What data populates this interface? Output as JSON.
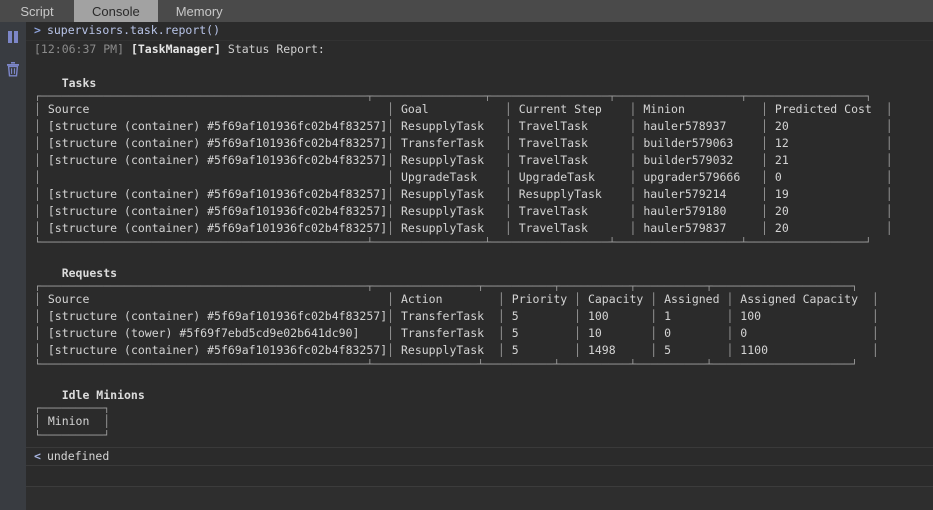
{
  "tabs": [
    {
      "label": "Script",
      "active": false
    },
    {
      "label": "Console",
      "active": true
    },
    {
      "label": "Memory",
      "active": false
    }
  ],
  "gutter": {
    "pause_icon": "pause-icon",
    "trash_icon": "trash-icon",
    "icon_color": "#7c86c8"
  },
  "console": {
    "command": "supervisors.task.report()",
    "input_prompt": ">",
    "output_prompt": "<",
    "output_value": "undefined",
    "status": {
      "timestamp": "[12:06:37 PM]",
      "tag": "[TaskManager]",
      "text": "Status Report:"
    },
    "sections": [
      {
        "title": "Tasks",
        "columns": [
          "Source",
          "Goal",
          "Current Step",
          "Minion",
          "Predicted Cost"
        ],
        "widths": [
          46,
          15,
          16,
          17,
          16
        ],
        "rows": [
          [
            "[structure (container) #5f69af101936fc02b4f83257]",
            "ResupplyTask",
            "TravelTask",
            "hauler578937",
            "20"
          ],
          [
            "[structure (container) #5f69af101936fc02b4f83257]",
            "TransferTask",
            "TravelTask",
            "builder579063",
            "12"
          ],
          [
            "[structure (container) #5f69af101936fc02b4f83257]",
            "ResupplyTask",
            "TravelTask",
            "builder579032",
            "21"
          ],
          [
            "",
            "UpgradeTask",
            "UpgradeTask",
            "upgrader579666",
            "0"
          ],
          [
            "[structure (container) #5f69af101936fc02b4f83257]",
            "ResupplyTask",
            "ResupplyTask",
            "hauler579214",
            "19"
          ],
          [
            "[structure (container) #5f69af101936fc02b4f83257]",
            "ResupplyTask",
            "TravelTask",
            "hauler579180",
            "20"
          ],
          [
            "[structure (container) #5f69af101936fc02b4f83257]",
            "ResupplyTask",
            "TravelTask",
            "hauler579837",
            "20"
          ]
        ]
      },
      {
        "title": "Requests",
        "columns": [
          "Source",
          "Action",
          "Priority",
          "Capacity",
          "Assigned",
          "Assigned Capacity"
        ],
        "widths": [
          46,
          14,
          9,
          9,
          9,
          19
        ],
        "rows": [
          [
            "[structure (container) #5f69af101936fc02b4f83257]",
            "TransferTask",
            "5",
            "100",
            "1",
            "100"
          ],
          [
            "[structure (tower) #5f69f7ebd5cd9e02b641dc90]",
            "TransferTask",
            "5",
            "10",
            "0",
            "0"
          ],
          [
            "[structure (container) #5f69af101936fc02b4f83257]",
            "ResupplyTask",
            "5",
            "1498",
            "5",
            "1100"
          ]
        ]
      },
      {
        "title": "Idle Minions",
        "columns": [
          "Minion"
        ],
        "widths": [
          8
        ],
        "rows": []
      }
    ]
  },
  "colors": {
    "console_bg": "#2b2b2b",
    "gutter_bg": "#393c41",
    "tabbar_bg": "#4a4a4a",
    "active_tab_bg": "#a2a2a2",
    "accent": "#7c86c8",
    "border": "#9a9a9a"
  }
}
